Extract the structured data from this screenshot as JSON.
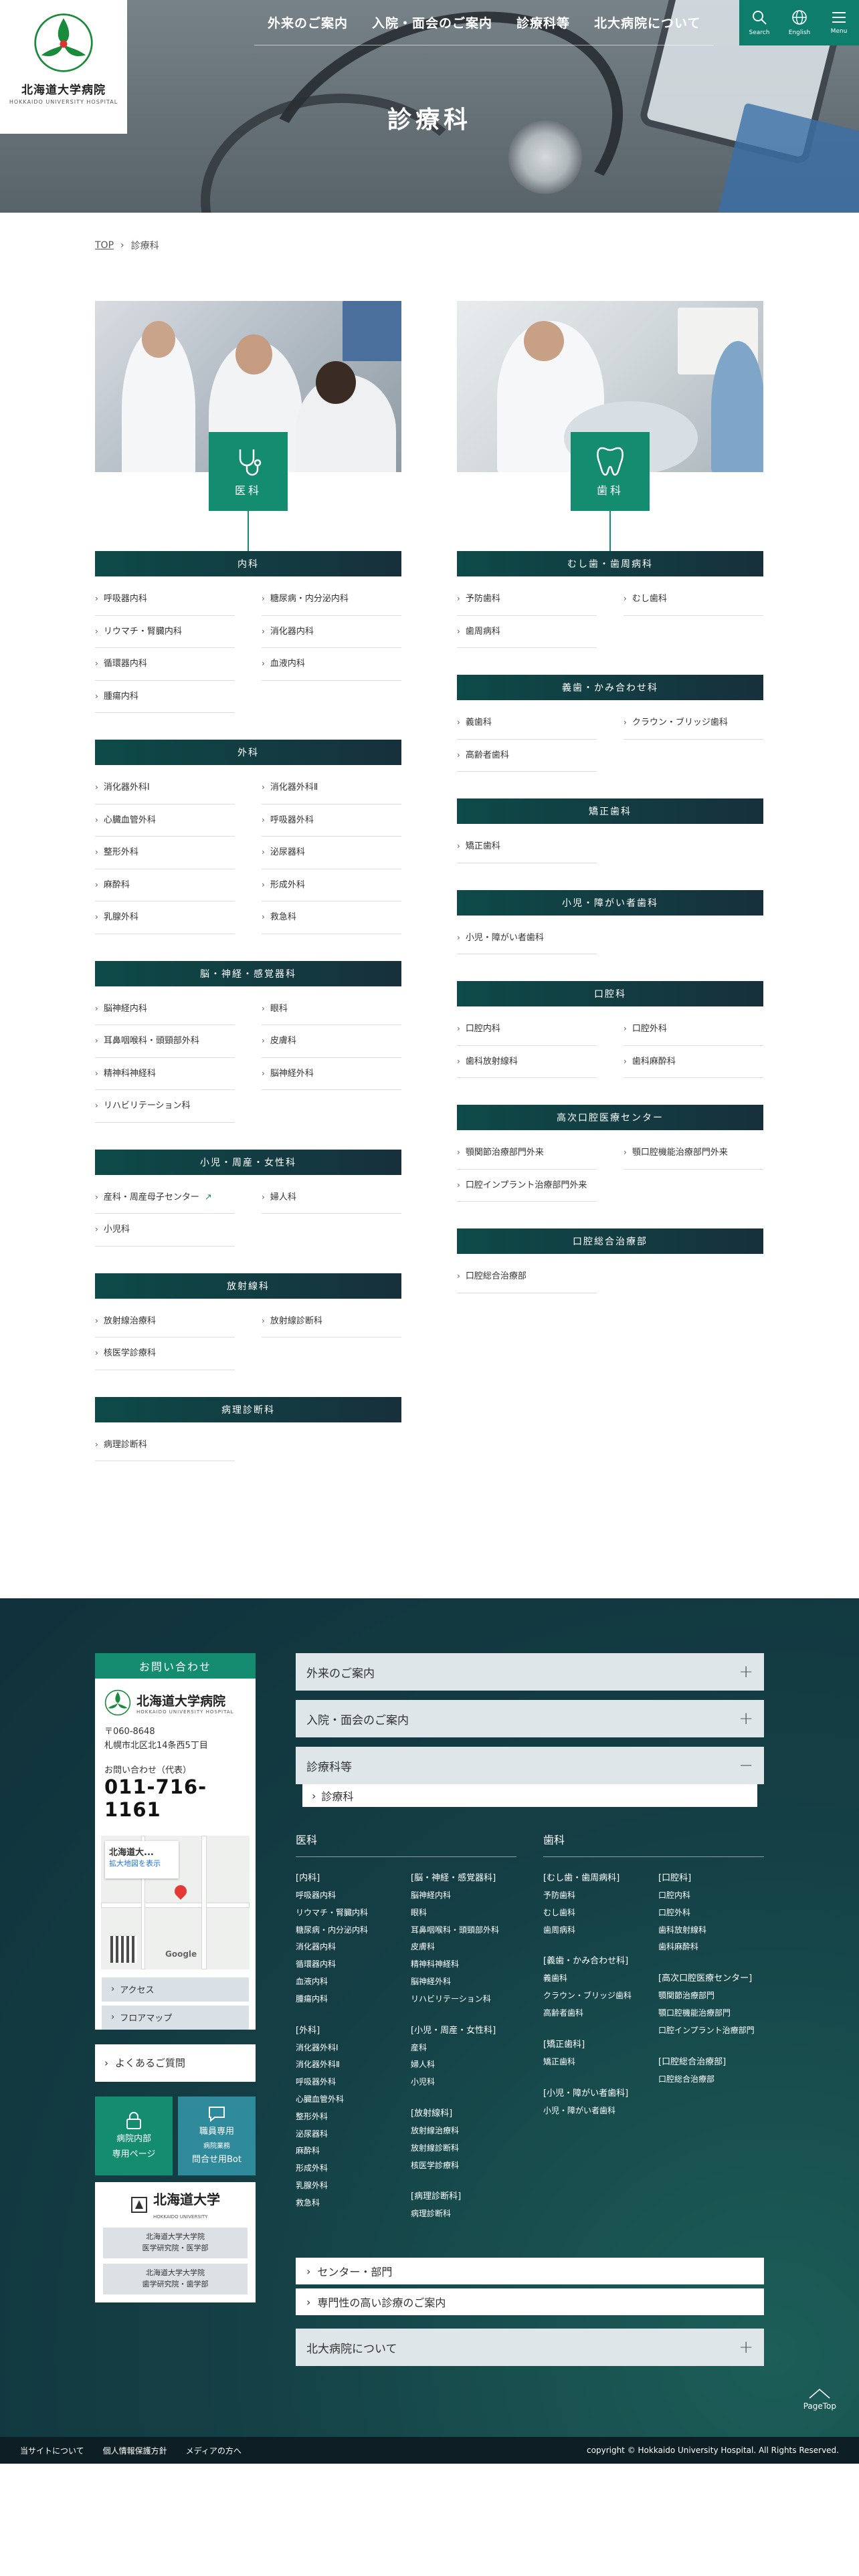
{
  "header": {
    "logo_jp": "北海道大学病院",
    "logo_en": "HOKKAIDO UNIVERSITY HOSPITAL",
    "nav": [
      "外来のご案内",
      "入院・面会のご案内",
      "診療科等",
      "北大病院について"
    ],
    "search_label": "Search",
    "english_label": "English",
    "menu_label": "Menu"
  },
  "page_title": "診療科",
  "breadcrumb": {
    "top": "TOP",
    "current": "診療科"
  },
  "medical": {
    "icon_label": "医科",
    "sections": [
      {
        "title": "内科",
        "items": [
          "呼吸器内科",
          "糖尿病・内分泌内科",
          "リウマチ・腎臓内科",
          "消化器内科",
          "循環器内科",
          "血液内科",
          "腫瘍内科"
        ]
      },
      {
        "title": "外科",
        "items": [
          "消化器外科Ⅰ",
          "消化器外科Ⅱ",
          "心臓血管外科",
          "呼吸器外科",
          "整形外科",
          "泌尿器科",
          "麻酔科",
          "形成外科",
          "乳腺外科",
          "救急科"
        ]
      },
      {
        "title": "脳・神経・感覚器科",
        "items": [
          "脳神経内科",
          "眼科",
          "耳鼻咽喉科・頭頸部外科",
          "皮膚科",
          "精神科神経科",
          "脳神経外科",
          "リハビリテーション科"
        ]
      },
      {
        "title": "小児・周産・女性科",
        "items": [
          "産科・周産母子センター",
          "婦人科",
          "小児科"
        ]
      },
      {
        "title": "放射線科",
        "items": [
          "放射線治療科",
          "放射線診断科",
          "核医学診療科"
        ]
      },
      {
        "title": "病理診断科",
        "items": [
          "病理診断科"
        ]
      }
    ]
  },
  "dental": {
    "icon_label": "歯科",
    "sections": [
      {
        "title": "むし歯・歯周病科",
        "items": [
          "予防歯科",
          "むし歯科",
          "歯周病科"
        ]
      },
      {
        "title": "義歯・かみ合わせ科",
        "items": [
          "義歯科",
          "クラウン・ブリッジ歯科",
          "高齢者歯科"
        ]
      },
      {
        "title": "矯正歯科",
        "items": [
          "矯正歯科"
        ]
      },
      {
        "title": "小児・障がい者歯科",
        "items": [
          "小児・障がい者歯科"
        ]
      },
      {
        "title": "口腔科",
        "items": [
          "口腔内科",
          "口腔外科",
          "歯科放射線科",
          "歯科麻酔科"
        ]
      },
      {
        "title": "高次口腔医療センター",
        "items": [
          "顎関節治療部門外来",
          "顎口腔機能治療部門外来",
          "口腔インプラント治療部門外来"
        ]
      },
      {
        "title": "口腔総合治療部",
        "items": [
          "口腔総合治療部"
        ]
      }
    ]
  },
  "footer": {
    "contact_title": "お問い合わせ",
    "logo_jp": "北海道大学病院",
    "logo_en": "HOKKAIDO UNIVERSITY HOSPITAL",
    "zip": "〒060-8648",
    "address": "札幌市北区北14条西5丁目",
    "tel_label": "お問い合わせ（代表）",
    "tel": "011-716-1161",
    "map_title": "北海道大...",
    "map_link": "拡大地図を表示",
    "map_brand": "Google",
    "access": "アクセス",
    "floor_map": "フロアマップ",
    "faq": "よくあるご質問",
    "staff_page_1": "病院内部",
    "staff_page_2": "専用ページ",
    "bot_1": "職員専用",
    "bot_2": "病院業務",
    "bot_3": "問合せ用Bot",
    "univ_jp": "北海道大学",
    "univ_en": "HOKKAIDO UNIVERSITY",
    "fac_med_1": "北海道大学大学院",
    "fac_med_2": "医学研究院・医学部",
    "fac_den_1": "北海道大学大学院",
    "fac_den_2": "歯学研究院・歯学部",
    "acc_outpatient": "外来のご案内",
    "acc_inpatient": "入院・面会のご案内",
    "acc_depts": "診療科等",
    "acc_depts_sub": "診療科",
    "mega_med": "医科",
    "mega_den": "歯科",
    "centers": "センター・部門",
    "specialized": "専門性の高い診療のご案内",
    "about": "北大病院について",
    "pagetop": "PageTop",
    "bottom_links": [
      "当サイトについて",
      "個人情報保護方針",
      "メディアの方へ"
    ],
    "copyright": "copyright © Hokkaido University Hospital. All Rights Reserved."
  },
  "mega_med_groups": [
    {
      "title": "[内科]",
      "items": [
        "呼吸器内科",
        "リウマチ・腎臓内科",
        "糖尿病・内分泌内科",
        "消化器内科",
        "循環器内科",
        "血液内科",
        "腫瘍内科"
      ]
    },
    {
      "title": "[外科]",
      "items": [
        "消化器外科Ⅰ",
        "消化器外科Ⅱ",
        "呼吸器外科",
        "心臓血管外科",
        "整形外科",
        "泌尿器科",
        "麻酔科",
        "形成外科",
        "乳腺外科",
        "救急科"
      ]
    },
    {
      "title": "[脳・神経・感覚器科]",
      "items": [
        "脳神経内科",
        "眼科",
        "耳鼻咽喉科・頭頸部外科",
        "皮膚科",
        "精神科神経科",
        "脳神経外科",
        "リハビリテーション科"
      ]
    },
    {
      "title": "[小児・周産・女性科]",
      "items": [
        "産科",
        "婦人科",
        "小児科"
      ]
    },
    {
      "title": "[放射線科]",
      "items": [
        "放射線治療科",
        "放射線診断科",
        "核医学診療科"
      ]
    },
    {
      "title": "[病理診断科]",
      "items": [
        "病理診断科"
      ]
    }
  ],
  "mega_den_groups": [
    {
      "title": "[むし歯・歯周病科]",
      "items": [
        "予防歯科",
        "むし歯科",
        "歯周病科"
      ]
    },
    {
      "title": "[義歯・かみ合わせ科]",
      "items": [
        "義歯科",
        "クラウン・ブリッジ歯科",
        "高齢者歯科"
      ]
    },
    {
      "title": "[矯正歯科]",
      "items": [
        "矯正歯科"
      ]
    },
    {
      "title": "[小児・障がい者歯科]",
      "items": [
        "小児・障がい者歯科"
      ]
    },
    {
      "title": "[口腔科]",
      "items": [
        "口腔内科",
        "口腔外科",
        "歯科放射線科",
        "歯科麻酔科"
      ]
    },
    {
      "title": "[高次口腔医療センター]",
      "items": [
        "顎関節治療部門",
        "顎口腔機能治療部門",
        "口腔インプラント治療部門"
      ]
    },
    {
      "title": "[口腔総合治療部]",
      "items": [
        "口腔総合治療部"
      ]
    }
  ],
  "colors": {
    "accent": "#138c70",
    "dark_header": "#0d4a48",
    "footer_bg": "#143f45"
  }
}
